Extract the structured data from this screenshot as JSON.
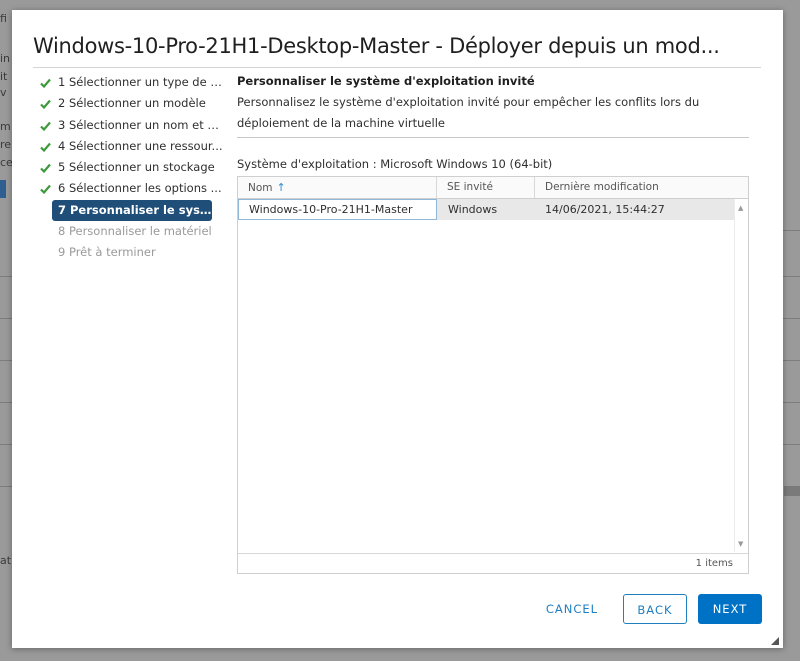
{
  "background": {
    "fragments": [
      "fi",
      "in",
      "it",
      "v",
      "m",
      "re",
      "ce",
      "at"
    ]
  },
  "modal": {
    "title": "Windows-10-Pro-21H1-Desktop-Master - Déployer depuis un mod..."
  },
  "steps": [
    {
      "label": "1 Sélectionner un type de c...",
      "state": "done"
    },
    {
      "label": "2 Sélectionner un modèle",
      "state": "done"
    },
    {
      "label": "3 Sélectionner un nom et u...",
      "state": "done"
    },
    {
      "label": "4 Sélectionner une ressour...",
      "state": "done"
    },
    {
      "label": "5 Sélectionner un stockage",
      "state": "done"
    },
    {
      "label": "6 Sélectionner les options ...",
      "state": "done"
    },
    {
      "label": "7 Personnaliser le système...",
      "state": "active"
    },
    {
      "label": "8 Personnaliser le matériel",
      "state": "disabled"
    },
    {
      "label": "9 Prêt à terminer",
      "state": "disabled"
    }
  ],
  "content": {
    "section_title": "Personnaliser le système d'exploitation invité",
    "section_desc": "Personnalisez le système d'exploitation invité pour empêcher les conflits lors du déploiement de la machine virtuelle",
    "os_line": "Système d'exploitation : Microsoft Windows 10 (64-bit)"
  },
  "grid": {
    "columns": [
      "Nom",
      "SE invité",
      "Dernière modification"
    ],
    "sort_icon": "arrow-up-icon",
    "rows": [
      [
        "Windows-10-Pro-21H1-Master",
        "Windows",
        "14/06/2021, 15:44:27"
      ]
    ],
    "footer": "1 items"
  },
  "buttons": {
    "cancel": "CANCEL",
    "back": "BACK",
    "next": "NEXT"
  },
  "colors": {
    "accent": "#0072c6",
    "active_step": "#1f4f78",
    "check": "#3c9a3c"
  }
}
